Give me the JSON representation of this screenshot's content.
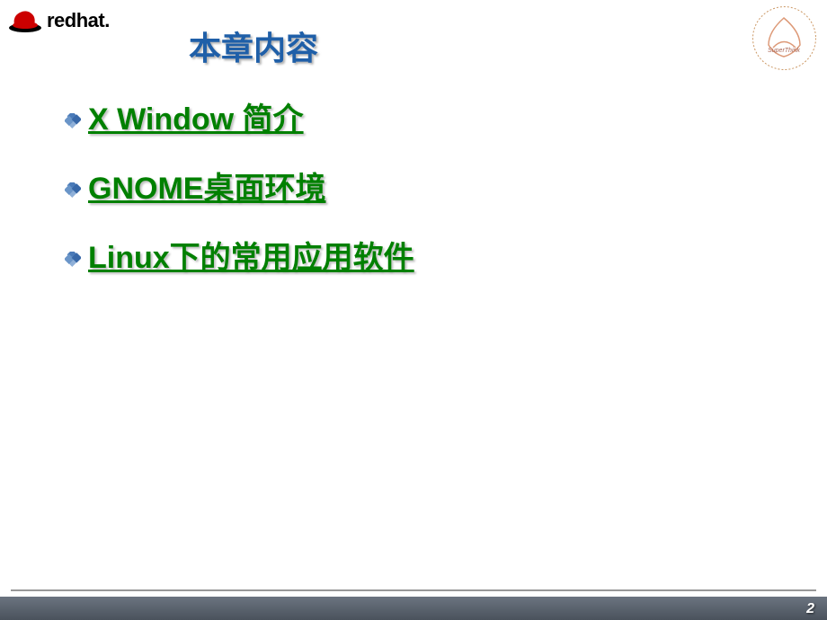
{
  "header": {
    "brand_text": "redhat.",
    "title": "本章内容"
  },
  "content": {
    "items": [
      {
        "label": "X Window 简介"
      },
      {
        "label": "GNOME桌面环境"
      },
      {
        "label": "Linux下的常用应用软件"
      }
    ]
  },
  "footer": {
    "page_number": "2"
  }
}
